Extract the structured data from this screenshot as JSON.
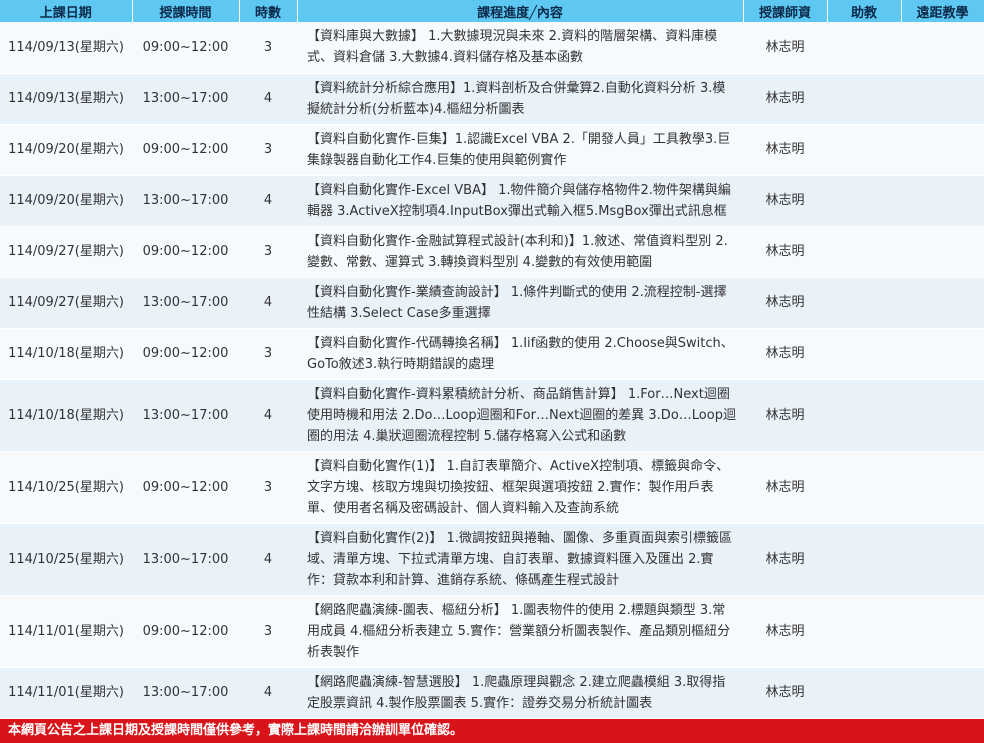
{
  "headers": [
    "上課日期",
    "授課時間",
    "時數",
    "課程進度╱內容",
    "授課師資",
    "助教",
    "遠距教學"
  ],
  "rows": [
    {
      "date": "114/09/13(星期六)",
      "time": "09:00~12:00",
      "hours": "3",
      "content": "【資料庫與大數據】 1.大數據現況與未來 2.資料的階層架構、資料庫模式、資料倉儲 3.大數據4.資料儲存格及基本函數",
      "teacher": "林志明",
      "ta": "",
      "remote": ""
    },
    {
      "date": "114/09/13(星期六)",
      "time": "13:00~17:00",
      "hours": "4",
      "content": "【資料統計分析綜合應用】1.資料剖析及合併彙算2.自動化資料分析 3.模擬統計分析(分析藍本)4.樞紐分析圖表",
      "teacher": "林志明",
      "ta": "",
      "remote": ""
    },
    {
      "date": "114/09/20(星期六)",
      "time": "09:00~12:00",
      "hours": "3",
      "content": "【資料自動化實作-巨集】1.認識Excel VBA 2.「開發人員」工具教學3.巨集錄製器自動化工作4.巨集的使用與範例實作",
      "teacher": "林志明",
      "ta": "",
      "remote": ""
    },
    {
      "date": "114/09/20(星期六)",
      "time": "13:00~17:00",
      "hours": "4",
      "content": "【資料自動化實作-Excel VBA】 1.物件簡介與儲存格物件2.物件架構與編輯器 3.ActiveX控制項4.InputBox彈出式輸入框5.MsgBox彈出式訊息框",
      "teacher": "林志明",
      "ta": "",
      "remote": ""
    },
    {
      "date": "114/09/27(星期六)",
      "time": "09:00~12:00",
      "hours": "3",
      "content": "【資料自動化實作-金融試算程式設計(本利和)】1.敘述、常值資料型別 2.變數、常數、運算式 3.轉換資料型別 4.變數的有效使用範圍",
      "teacher": "林志明",
      "ta": "",
      "remote": ""
    },
    {
      "date": "114/09/27(星期六)",
      "time": "13:00~17:00",
      "hours": "4",
      "content": "【資料自動化實作-業績查詢設計】 1.條件判斷式的使用 2.流程控制-選擇性結構 3.Select Case多重選擇",
      "teacher": "林志明",
      "ta": "",
      "remote": ""
    },
    {
      "date": "114/10/18(星期六)",
      "time": "09:00~12:00",
      "hours": "3",
      "content": "【資料自動化實作-代碼轉換名稱】 1.Iif函數的使用 2.Choose與Switch、GoTo敘述3.執行時期錯誤的處理",
      "teacher": "林志明",
      "ta": "",
      "remote": ""
    },
    {
      "date": "114/10/18(星期六)",
      "time": "13:00~17:00",
      "hours": "4",
      "content": "【資料自動化實作-資料累積統計分析、商品銷售計算】 1.For…Next迴圈使用時機和用法 2.Do…Loop迴圈和For…Next迴圈的差異 3.Do…Loop迴圈的用法 4.巢狀迴圈流程控制 5.儲存格寫入公式和函數",
      "teacher": "林志明",
      "ta": "",
      "remote": ""
    },
    {
      "date": "114/10/25(星期六)",
      "time": "09:00~12:00",
      "hours": "3",
      "content": "【資料自動化實作(1)】 1.自訂表單簡介、ActiveX控制項、標籤與命令、文字方塊、核取方塊與切換按鈕、框架與選項按鈕 2.實作：製作用戶表單、使用者名稱及密碼設計、個人資料輸入及查詢系統",
      "teacher": "林志明",
      "ta": "",
      "remote": ""
    },
    {
      "date": "114/10/25(星期六)",
      "time": "13:00~17:00",
      "hours": "4",
      "content": "【資料自動化實作(2)】 1.微調按鈕與捲軸、圖像、多重頁面與索引標籤區域、清單方塊、下拉式清單方塊、自訂表單、數據資料匯入及匯出 2.實作：貸款本利和計算、進銷存系統、條碼產生程式設計",
      "teacher": "林志明",
      "ta": "",
      "remote": ""
    },
    {
      "date": "114/11/01(星期六)",
      "time": "09:00~12:00",
      "hours": "3",
      "content": "【網路爬蟲演練-圖表、樞紐分析】 1.圖表物件的使用 2.標題與類型 3.常用成員 4.樞紐分析表建立 5.實作：營業額分析圖表製作、產品類別樞紐分析表製作",
      "teacher": "林志明",
      "ta": "",
      "remote": ""
    },
    {
      "date": "114/11/01(星期六)",
      "time": "13:00~17:00",
      "hours": "4",
      "content": "【網路爬蟲演練-智慧選股】 1.爬蟲原理與觀念 2.建立爬蟲模組 3.取得指定股票資訊 4.製作股票圖表 5.實作：證券交易分析統計圖表",
      "teacher": "林志明",
      "ta": "",
      "remote": ""
    }
  ],
  "notice": "本網頁公告之上課日期及授課時間僅供參考，實際上課時間請洽辦訓單位確認。"
}
